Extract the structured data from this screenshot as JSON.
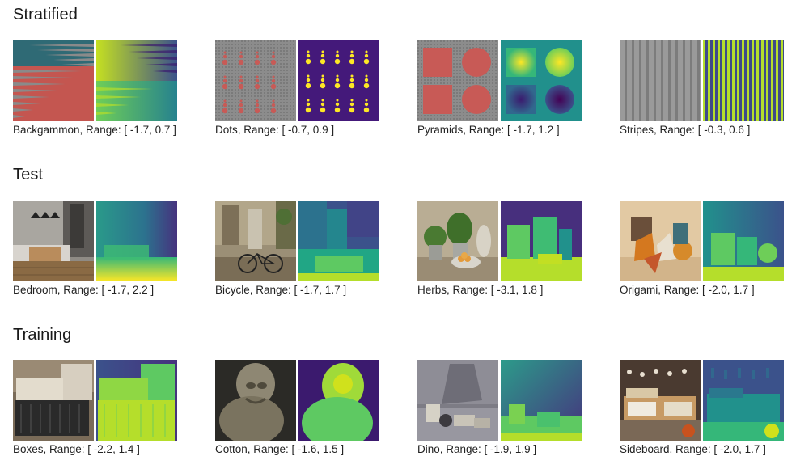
{
  "sections": [
    {
      "title": "Stratified",
      "items": [
        {
          "caption": "Backgammon, Range: [ -1.7, 0.7 ]",
          "scene": "backgammon-image",
          "depth": "backgammon-depth-map"
        },
        {
          "caption": "Dots, Range: [ -0.7, 0.9 ]",
          "scene": "dots-image",
          "depth": "dots-depth-map"
        },
        {
          "caption": "Pyramids, Range: [ -1.7, 1.2 ]",
          "scene": "pyramids-image",
          "depth": "pyramids-depth-map"
        },
        {
          "caption": "Stripes, Range: [ -0.3, 0.6 ]",
          "scene": "stripes-image",
          "depth": "stripes-depth-map"
        }
      ]
    },
    {
      "title": "Test",
      "items": [
        {
          "caption": "Bedroom, Range: [ -1.7, 2.2 ]",
          "scene": "bedroom-image",
          "depth": "bedroom-depth-map"
        },
        {
          "caption": "Bicycle, Range: [ -1.7, 1.7 ]",
          "scene": "bicycle-image",
          "depth": "bicycle-depth-map"
        },
        {
          "caption": "Herbs, Range: [ -3.1, 1.8 ]",
          "scene": "herbs-image",
          "depth": "herbs-depth-map"
        },
        {
          "caption": "Origami, Range: [ -2.0, 1.7 ]",
          "scene": "origami-image",
          "depth": "origami-depth-map"
        }
      ]
    },
    {
      "title": "Training",
      "items": [
        {
          "caption": "Boxes, Range: [ -2.2, 1.4 ]",
          "scene": "boxes-image",
          "depth": "boxes-depth-map"
        },
        {
          "caption": "Cotton, Range: [ -1.6, 1.5 ]",
          "scene": "cotton-image",
          "depth": "cotton-depth-map"
        },
        {
          "caption": "Dino, Range: [ -1.9, 1.9 ]",
          "scene": "dino-image",
          "depth": "dino-depth-map"
        },
        {
          "caption": "Sideboard, Range: [ -2.0, 1.7 ]",
          "scene": "sideboard-image",
          "depth": "sideboard-depth-map"
        }
      ]
    }
  ],
  "colors": {
    "viridis_dark": "#3b1a6e",
    "viridis_mid": "#21908c",
    "viridis_light": "#5dc863",
    "viridis_yellow": "#fde725",
    "pattern_red": "#c85a56",
    "pattern_gray": "#8a8a8a"
  }
}
